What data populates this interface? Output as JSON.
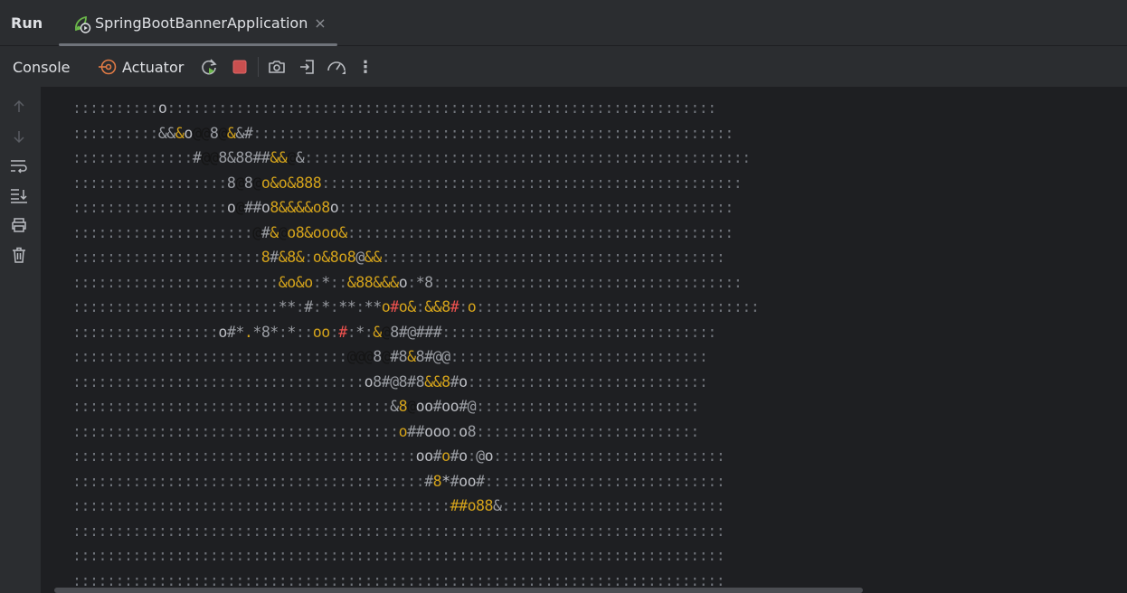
{
  "window": {
    "panel_title": "Run",
    "run_tab": {
      "label": "SpringBootBannerApplication",
      "close_glyph": "×",
      "icon": "spring-boot-run-icon"
    }
  },
  "toolbar": {
    "console_tab": "Console",
    "actuator_tab": "Actuator",
    "buttons": [
      "rerun-icon",
      "stop-icon",
      "screenshot-icon",
      "exit-icon",
      "profiler-icon",
      "more-icon"
    ],
    "more_glyph": "⋮"
  },
  "gutter": {
    "buttons": [
      "arrow-up-icon",
      "arrow-down-icon",
      "soft-wrap-icon",
      "scroll-to-end-icon",
      "print-icon",
      "trash-icon"
    ]
  },
  "colors": {
    "dim": "#6f737a",
    "gray": "#9a9da3",
    "light": "#bcbec4",
    "yellow": "#d4a31b",
    "red": "#f0524f",
    "dark": "#141414",
    "spring_green": "#6bb84a",
    "stop_red": "#c94f4f"
  },
  "console": {
    "lines": [
      [
        [
          "d",
          "::::::::::"
        ],
        [
          "l",
          "o"
        ],
        [
          "d",
          "::::::::::::::::::::::::::::::::::::::::::::::::::::::::::::::::"
        ]
      ],
      [
        [
          "d",
          "::::::::::"
        ],
        [
          "g",
          "&&"
        ],
        [
          "y",
          "&"
        ],
        [
          "l",
          "o"
        ],
        [
          "k",
          "@@"
        ],
        [
          "g",
          "8"
        ],
        [
          "k",
          "@"
        ],
        [
          "y",
          "&"
        ],
        [
          "g",
          "&#"
        ],
        [
          "d",
          "::::::::::::::::::::::::::::::::::::::::::::::::::::::::"
        ]
      ],
      [
        [
          "d",
          "::::::::::::::"
        ],
        [
          "g",
          "#"
        ],
        [
          "k",
          "@@"
        ],
        [
          "g",
          "8&88##"
        ],
        [
          "y",
          "&&"
        ],
        [
          "k",
          "@"
        ],
        [
          "g",
          "&"
        ],
        [
          "d",
          "::::::::::::::::::::::::::::::::::::::::::::::::::::"
        ]
      ],
      [
        [
          "d",
          "::::::::::::::::::"
        ],
        [
          "g",
          "8"
        ],
        [
          "k",
          "@"
        ],
        [
          "g",
          "8"
        ],
        [
          "k",
          "@"
        ],
        [
          "y",
          "o&o&888"
        ],
        [
          "d",
          ":::::::::::::::::::::::::::::::::::::::::::::::::"
        ]
      ],
      [
        [
          "d",
          "::::::::::::::::::"
        ],
        [
          "l",
          "o"
        ],
        [
          "k",
          "@"
        ],
        [
          "g",
          "##"
        ],
        [
          "l",
          "o"
        ],
        [
          "y",
          "8&&&&o8"
        ],
        [
          "l",
          "o"
        ],
        [
          "d",
          "::::::::::::::::::::::::::::::::::::::::::::::"
        ]
      ],
      [
        [
          "d",
          ":::::::::::::::::::::"
        ],
        [
          "k",
          "@"
        ],
        [
          "g",
          "#"
        ],
        [
          "y",
          "&"
        ],
        [
          "k",
          "@"
        ],
        [
          "y",
          "o8&ooo&"
        ],
        [
          "d",
          ":::::::::::::::::::::::::::::::::::::::::::::"
        ]
      ],
      [
        [
          "d",
          "::::::::::::::::::::::"
        ],
        [
          "y",
          "8"
        ],
        [
          "g",
          "#"
        ],
        [
          "y",
          "&8&"
        ],
        [
          "d",
          ":"
        ],
        [
          "y",
          "o&8o8"
        ],
        [
          "g",
          "@"
        ],
        [
          "y",
          "&&"
        ],
        [
          "d",
          "::::::::::::::::::::::::::::::::::::::::"
        ]
      ],
      [
        [
          "d",
          "::::::::::::::::::::::::"
        ],
        [
          "y",
          "&o&o"
        ],
        [
          "d",
          ":"
        ],
        [
          "g",
          "*"
        ],
        [
          "d",
          "::"
        ],
        [
          "y",
          "&88&&&"
        ],
        [
          "l",
          "o"
        ],
        [
          "d",
          ":"
        ],
        [
          "g",
          "*8"
        ],
        [
          "d",
          "::::::::::::::::::::::::::::::::::::"
        ]
      ],
      [
        [
          "d",
          "::::::::::::::::::::::::"
        ],
        [
          "g",
          "**"
        ],
        [
          "d",
          ":"
        ],
        [
          "g",
          "#"
        ],
        [
          "d",
          ":"
        ],
        [
          "g",
          "*"
        ],
        [
          "d",
          ":"
        ],
        [
          "g",
          "**"
        ],
        [
          "d",
          ":"
        ],
        [
          "g",
          "**"
        ],
        [
          "y",
          "o"
        ],
        [
          "r",
          "#"
        ],
        [
          "y",
          "o&"
        ],
        [
          "d",
          ":"
        ],
        [
          "y",
          "&&8"
        ],
        [
          "r",
          "#"
        ],
        [
          "d",
          ":"
        ],
        [
          "y",
          "o"
        ],
        [
          "d",
          ":::::::::::::::::::::::::::::::::"
        ]
      ],
      [
        [
          "d",
          ":::::::::::::::::"
        ],
        [
          "l",
          "o"
        ],
        [
          "g",
          "#*"
        ],
        [
          "y",
          "."
        ],
        [
          "g",
          "*8*"
        ],
        [
          "d",
          ":"
        ],
        [
          "g",
          "*"
        ],
        [
          "d",
          "::"
        ],
        [
          "y",
          "oo"
        ],
        [
          "d",
          ":"
        ],
        [
          "r",
          "#"
        ],
        [
          "d",
          ":"
        ],
        [
          "g",
          "*"
        ],
        [
          "d",
          ":"
        ],
        [
          "y",
          "&"
        ],
        [
          "k",
          "@"
        ],
        [
          "g",
          "8#@###"
        ],
        [
          "d",
          "::::::::::::::::::::::::::::::::"
        ]
      ],
      [
        [
          "d",
          "::::::::::::::::::::::::::::::::"
        ],
        [
          "k",
          "@@@"
        ],
        [
          "g",
          "8"
        ],
        [
          "k",
          "@"
        ],
        [
          "g",
          "#8"
        ],
        [
          "y",
          "&"
        ],
        [
          "g",
          "8#@@"
        ],
        [
          "d",
          "::::::::::::::::::::::::::::::"
        ]
      ],
      [
        [
          "d",
          "::::::::::::::::::::::::::::::::::"
        ],
        [
          "l",
          "o"
        ],
        [
          "g",
          "8#@8#8"
        ],
        [
          "y",
          "&&8"
        ],
        [
          "g",
          "#"
        ],
        [
          "l",
          "o"
        ],
        [
          "d",
          "::::::::::::::::::::::::::::"
        ]
      ],
      [
        [
          "d",
          ":::::::::::::::::::::::::::::::::::::"
        ],
        [
          "g",
          "&"
        ],
        [
          "y",
          "8"
        ],
        [
          "k",
          "@"
        ],
        [
          "l",
          "oo"
        ],
        [
          "g",
          "#"
        ],
        [
          "l",
          "oo"
        ],
        [
          "g",
          "#@"
        ],
        [
          "d",
          "::::::::::::::::::::::::::"
        ]
      ],
      [
        [
          "d",
          "::::::::::::::::::::::::::::::::::::::"
        ],
        [
          "y",
          "o"
        ],
        [
          "g",
          "##"
        ],
        [
          "l",
          "ooo"
        ],
        [
          "d",
          ":"
        ],
        [
          "l",
          "o"
        ],
        [
          "g",
          "8"
        ],
        [
          "d",
          "::::::::::::::::::::::::::"
        ]
      ],
      [
        [
          "d",
          "::::::::::::::::::::::::::::::::::::::::"
        ],
        [
          "l",
          "oo"
        ],
        [
          "g",
          "#"
        ],
        [
          "y",
          "o"
        ],
        [
          "g",
          "#"
        ],
        [
          "l",
          "o"
        ],
        [
          "d",
          ":"
        ],
        [
          "g",
          "@"
        ],
        [
          "l",
          "o"
        ],
        [
          "d",
          ":::::::::::::::::::::::::::"
        ]
      ],
      [
        [
          "d",
          ":::::::::::::::::::::::::::::::::::::::::"
        ],
        [
          "g",
          "#"
        ],
        [
          "y",
          "8"
        ],
        [
          "l",
          "*"
        ],
        [
          "g",
          "#"
        ],
        [
          "l",
          "oo"
        ],
        [
          "g",
          "#"
        ],
        [
          "d",
          "::::::::::::::::::::::::::::"
        ]
      ],
      [
        [
          "d",
          "::::::::::::::::::::::::::::::::::::::::::::"
        ],
        [
          "y",
          "##"
        ],
        [
          "r",
          ""
        ],
        [
          "y",
          "o88"
        ],
        [
          "g",
          "&"
        ],
        [
          "d",
          "::::::::::::::::::::::::::"
        ]
      ],
      [
        [
          "d",
          "::::::::::::::::::::::::::::::::::::::::::::::::::::::::::::::::::::::::::::"
        ]
      ],
      [
        [
          "d",
          "::::::::::::::::::::::::::::::::::::::::::::::::::::::::::::::::::::::::::::"
        ]
      ],
      [
        [
          "d",
          "::::::::::::::::::::::::::::::::::::::::::::::::::::::::::::::::::::::::::::"
        ]
      ]
    ]
  }
}
